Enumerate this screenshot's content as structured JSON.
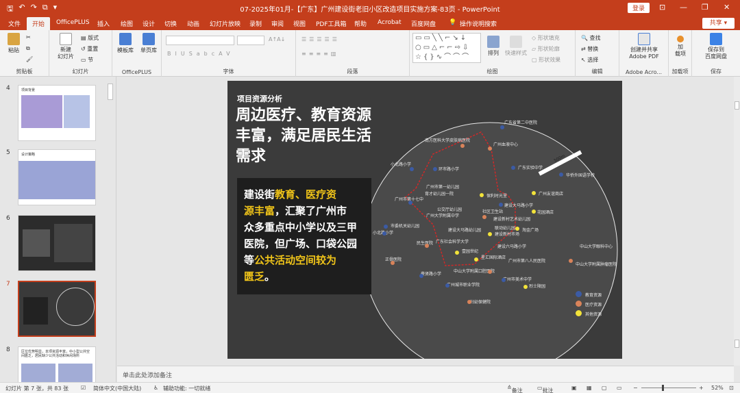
{
  "window": {
    "title": "07-2025年01月-【广东】广州建设街老旧小区改造项目实施方案-83页  -  PowerPoint",
    "login_label": "登录",
    "qat_icons": [
      "save-icon",
      "undo-icon",
      "redo-icon",
      "present-icon",
      "customize-icon"
    ]
  },
  "tabs": [
    {
      "label": "文件",
      "active": false
    },
    {
      "label": "开始",
      "active": true
    },
    {
      "label": "OfficePLUS",
      "active": false
    },
    {
      "label": "插入",
      "active": false
    },
    {
      "label": "绘图",
      "active": false
    },
    {
      "label": "设计",
      "active": false
    },
    {
      "label": "切换",
      "active": false
    },
    {
      "label": "动画",
      "active": false
    },
    {
      "label": "幻灯片放映",
      "active": false
    },
    {
      "label": "录制",
      "active": false
    },
    {
      "label": "审阅",
      "active": false
    },
    {
      "label": "视图",
      "active": false
    },
    {
      "label": "PDF工具箱",
      "active": false
    },
    {
      "label": "帮助",
      "active": false
    },
    {
      "label": "Acrobat",
      "active": false
    },
    {
      "label": "百度网盘",
      "active": false
    },
    {
      "label": "操作说明搜索",
      "active": false
    }
  ],
  "share_label": "共享",
  "ribbon": {
    "groups": [
      "剪贴板",
      "幻灯片",
      "OfficePLUS",
      "字体",
      "段落",
      "绘图",
      "编辑",
      "Adobe Acro...",
      "加载项",
      "保存"
    ],
    "paste": "粘贴",
    "new_slide": "新建\n幻灯片",
    "layout": "版式",
    "reset": "重置",
    "section": "节",
    "template_lib": "模板库",
    "single_lib": "单页库",
    "arrange": "排列",
    "quick_styles": "快速样式",
    "shape_fill": "形状填充",
    "shape_outline": "形状轮廓",
    "shape_effects": "形状效果",
    "find": "查找",
    "replace": "替换",
    "select": "选择",
    "create_share": "创建并共享\nAdobe PDF",
    "addins": "加\n载项",
    "save_baidu": "保存到\n百度网盘"
  },
  "slides": [
    {
      "num": "4",
      "active": false
    },
    {
      "num": "5",
      "active": false
    },
    {
      "num": "6",
      "active": false
    },
    {
      "num": "7",
      "active": true
    },
    {
      "num": "8",
      "active": false
    }
  ],
  "thumb_text": {
    "t4_title": "项目背景",
    "t5_title": "设计策略",
    "t8_title": "区位优势明显，本项资源丰富，中小型公共空间匮乏，居民缺少公共活动和休闲场所"
  },
  "slide": {
    "label": "项目资源分析",
    "headline_1": "周边医疗、教育资源",
    "headline_2": "丰富，满足居民生活",
    "headline_3": "需求",
    "body_p1": "建设街",
    "body_h1": "教育、医疗资",
    "body_h2": "源丰富",
    "body_p2": "，汇聚了广州市",
    "body_p3": "众多重点中小学以及三甲",
    "body_p4": "医院，但广场、口袋公园",
    "body_p5": "等",
    "body_h3": "公共活动空间较为",
    "body_h4": "匮乏",
    "body_p6": "。",
    "scale_label": "500m",
    "legend": [
      {
        "label": "教育资源",
        "color": "#3b5ba5"
      },
      {
        "label": "医疗资源",
        "color": "#d9835a"
      },
      {
        "label": "其他资源",
        "color": "#f2e33a"
      }
    ],
    "places": [
      "广东省第二中医院",
      "南方医科大学皮肤病医院",
      "广州血液中心",
      "小北路小学",
      "环市路小学",
      "广东实验中学",
      "华侨外国语学校",
      "广州市第一幼儿园",
      "育才幼儿园一院",
      "保利时光里",
      "广州友谊商店",
      "广州市第十七中",
      "建设大马路小学",
      "公交厅幼儿园",
      "社区卫生站",
      "花园酒店",
      "广州大学附属中学",
      "建设新村艺术幼儿园",
      "市委机关幼儿园",
      "建设大马路幼儿园",
      "联动幼儿园",
      "淘金广场",
      "小北路小学",
      "建设新村市场",
      "民生医院",
      "广东社会科学大学",
      "建设六马路小学",
      "中山大学眼科中心",
      "壹园世纪",
      "星汇国际酒店",
      "正骨医院",
      "广州市第八人民医院",
      "中山大学附属肿瘤医院",
      "豪贤路小学",
      "中山大学附属口腔医院",
      "广州市美术中学",
      "广州城市职业学院",
      "烈士陵园",
      "妇幼保健院"
    ]
  },
  "notes_placeholder": "单击此处添加备注",
  "status": {
    "slide_of": "幻灯片 第 7 张，共 83 张",
    "lang": "简体中文(中国大陆)",
    "access": "辅助功能: 一切就绪",
    "notes": "备注",
    "comments": "批注",
    "zoom": "52%"
  }
}
